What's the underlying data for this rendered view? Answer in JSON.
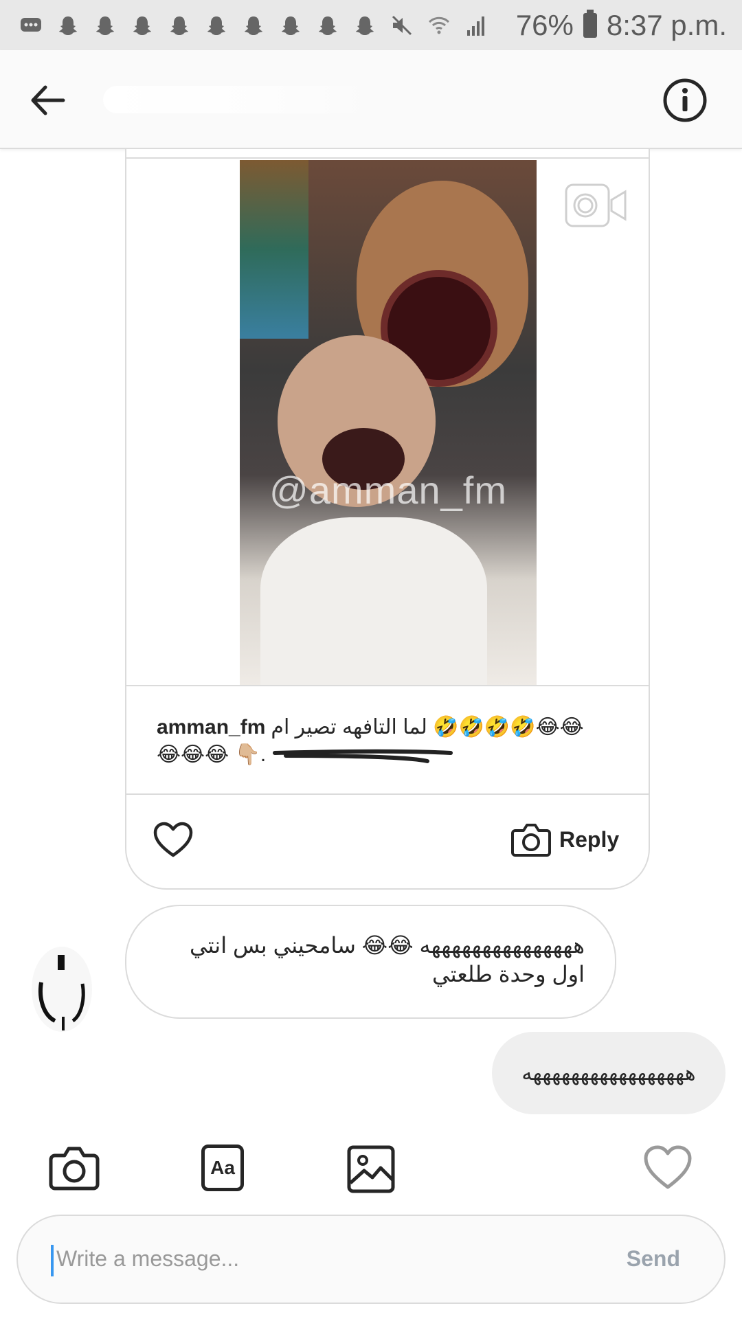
{
  "status_bar": {
    "battery": "76%",
    "time": "8:37 p.m.",
    "icons": [
      "messages-icon",
      "snapchat-icon",
      "snapchat-icon",
      "snapchat-icon",
      "snapchat-icon",
      "snapchat-icon",
      "snapchat-icon",
      "snapchat-icon",
      "snapchat-icon",
      "snapchat-icon",
      "mute-icon",
      "wifi-icon",
      "signal-icon",
      "battery-icon"
    ]
  },
  "header": {
    "back_icon": "arrow-left-icon",
    "title": "",
    "info_icon": "info-icon"
  },
  "shared_post": {
    "watermark": "@amman_fm",
    "username": "amman_fm",
    "caption_text": "لما التافهه تصير ام 🤣🤣🤣🤣😂😂",
    "caption_line2": "😂😂😂 👇🏼.",
    "video_icon": "video-camera-icon",
    "like_icon": "heart-outline-icon",
    "reply_label": "Reply",
    "reply_icon": "camera-icon"
  },
  "messages": [
    {
      "direction": "received",
      "text": "هههههههههههههههه 😂😂 سامحيني بس انتي اول وحدة طلعتي"
    },
    {
      "direction": "sent",
      "text": "هههههههههههههههههه"
    }
  ],
  "composer": {
    "tools": [
      "camera-icon",
      "text-format-icon",
      "gallery-icon",
      "heart-icon"
    ],
    "text_tool_label": "Aa",
    "placeholder": "Write a message...",
    "send_label": "Send"
  },
  "colors": {
    "status_bar_bg": "#e8e8e8",
    "header_bg": "#fafafa",
    "border": "#dbdbdb",
    "sent_bubble": "#efefef",
    "caret": "#3897f0",
    "send_text": "#9aa3ad"
  }
}
